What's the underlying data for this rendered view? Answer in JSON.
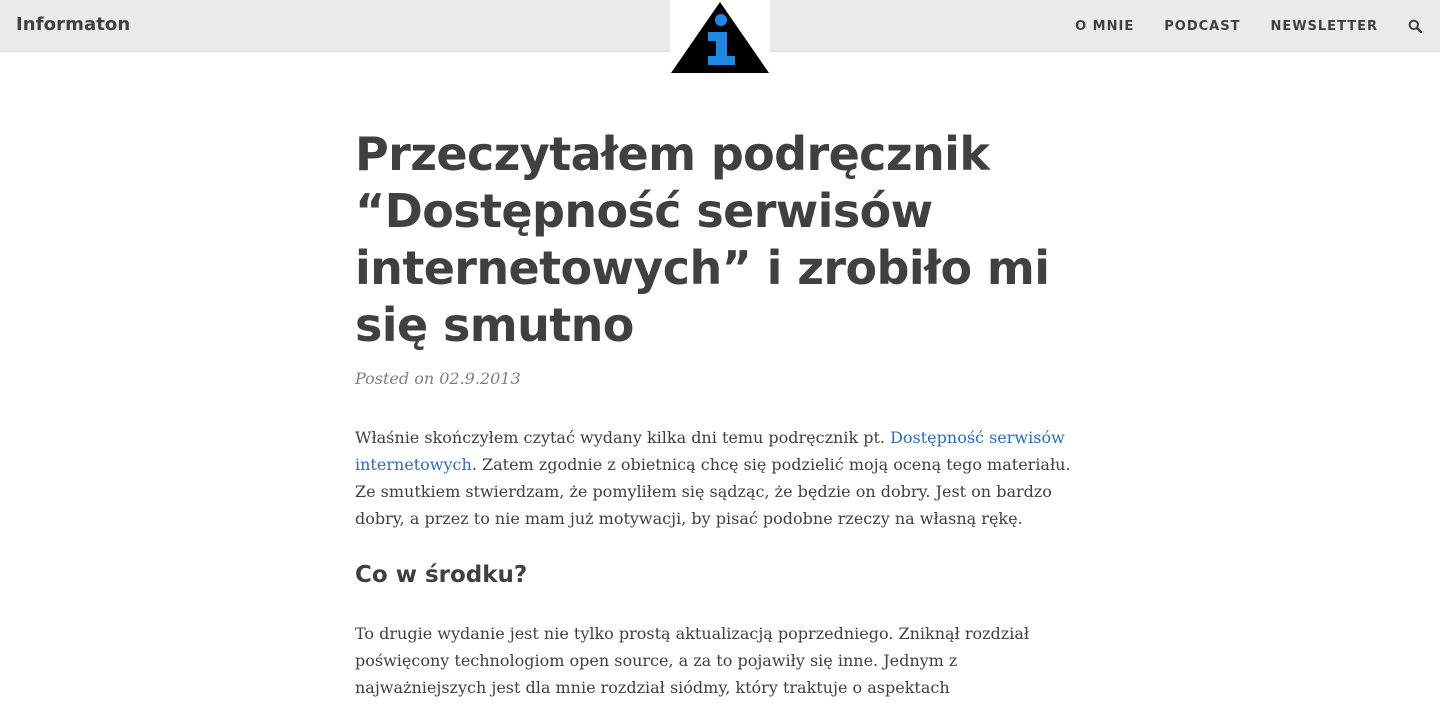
{
  "navbar": {
    "brand": "Informaton",
    "logo": {
      "icon": "info-triangle-logo",
      "letter": "i",
      "colors": {
        "triangle": "#000000",
        "letter": "#1e88e5"
      }
    },
    "menu": [
      {
        "label": "O MNIE"
      },
      {
        "label": "PODCAST"
      },
      {
        "label": "NEWSLETTER"
      }
    ],
    "search_icon": "search-icon"
  },
  "post": {
    "title": "Przeczytałem podręcznik “Dostępność serwisów internetowych” i zrobiło mi się smutno",
    "meta": "Posted on 02.9.2013",
    "intro": {
      "before_link": "Właśnie skończyłem czytać wydany kilka dni temu podręcznik pt. ",
      "link_text": "Dostępność serwisów internetowych",
      "after_link": ". Zatem zgodnie z obietnicą chcę się podzielić moją oceną tego materiału. Ze smutkiem stwierdzam, że pomyliłem się sądząc, że będzie on dobry. Jest on bardzo dobry, a przez to nie mam już motywacji, by pisać podobne rzeczy na własną rękę."
    },
    "section_heading": "Co w środku?",
    "paragraph_2": "To drugie wydanie jest nie tylko prostą aktualizacją poprzedniego. Zniknął rozdział poświęcony technologiom open source, a za to pojawiły się inne. Jednym z najważniejszych jest dla mnie rozdział siódmy, który traktuje o aspektach"
  },
  "colors": {
    "navbar_bg": "#eaeaea",
    "text": "#404040",
    "meta": "#808080",
    "link": "#2a6dc0"
  }
}
